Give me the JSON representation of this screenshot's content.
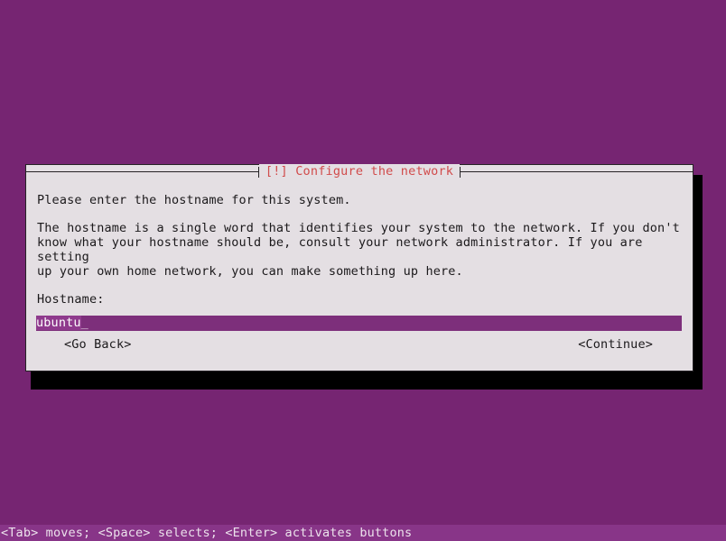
{
  "screen": {
    "background_color": "#762572"
  },
  "dialog": {
    "title": "[!] Configure the network",
    "title_color": "#d14b4b",
    "background_color": "#e4dfe3",
    "border_color": "#262326",
    "intro_text": "Please enter the hostname for this system.",
    "explain_text": "The hostname is a single word that identifies your system to the network. If you don't\nknow what your hostname should be, consult your network administrator. If you are setting\nup your own home network, you can make something up here.",
    "field": {
      "label": "Hostname:",
      "value": "ubuntu",
      "cursor": "_",
      "fill": "_________________________________________________________________________________________________",
      "field_background": "#7d2f7b",
      "selection_background": "#8f3a8d",
      "selection_color": "#ffffff"
    },
    "buttons": {
      "go_back": "<Go Back>",
      "continue": "<Continue>"
    }
  },
  "statusbar": {
    "hint": "<Tab> moves; <Space> selects; <Enter> activates buttons",
    "background_color": "#883588"
  }
}
